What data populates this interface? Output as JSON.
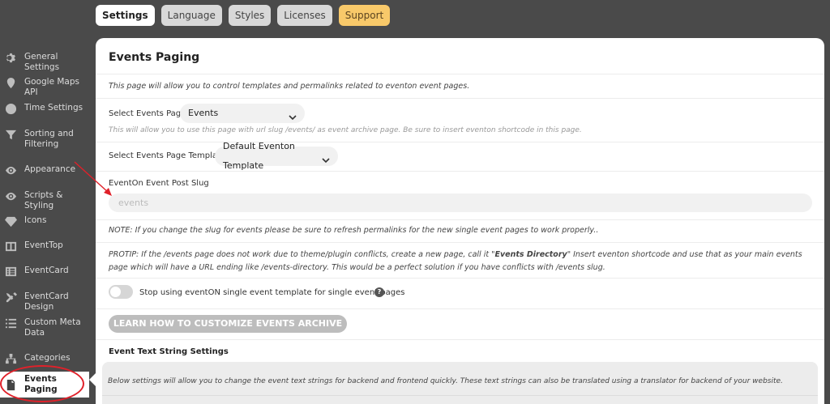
{
  "tabs": [
    {
      "label": "Settings",
      "active": true
    },
    {
      "label": "Language",
      "active": false
    },
    {
      "label": "Styles",
      "active": false
    },
    {
      "label": "Licenses",
      "active": false
    },
    {
      "label": "Support",
      "active": false
    }
  ],
  "sidebar": {
    "items": [
      {
        "label": "General Settings",
        "icon": "gear-icon"
      },
      {
        "label": "Google Maps API",
        "icon": "map-pin-icon"
      },
      {
        "label": "Time Settings",
        "icon": "clock-icon"
      },
      {
        "label": "Sorting and Filtering",
        "icon": "filter-icon"
      },
      {
        "label": "Appearance",
        "icon": "eye-icon"
      },
      {
        "label": "Scripts & Styling",
        "icon": "eye-icon"
      },
      {
        "label": "Icons",
        "icon": "diamond-icon"
      },
      {
        "label": "EventTop",
        "icon": "layout-icon"
      },
      {
        "label": "EventCard",
        "icon": "card-icon"
      },
      {
        "label": "EventCard Design",
        "icon": "tools-icon"
      },
      {
        "label": "Custom Meta Data",
        "icon": "list-icon"
      },
      {
        "label": "Categories",
        "icon": "hierarchy-icon"
      },
      {
        "label": "Events Paging",
        "icon": "file-icon",
        "active": true
      }
    ]
  },
  "main": {
    "title": "Events Paging",
    "intro": "This page will allow you to control templates and permalinks related to eventon event pages.",
    "events_page": {
      "label": "Select Events Page",
      "value": "Events",
      "note": "This will allow you to use this page with url slug /events/ as event archive page. Be sure to insert eventon shortcode in this page."
    },
    "template": {
      "label": "Select Events Page Template",
      "value": "Default Eventon Template"
    },
    "slug": {
      "label": "EventOn Event Post Slug",
      "placeholder": "events"
    },
    "slug_note": "NOTE: If you change the slug for events please be sure to refresh permalinks for the new single event pages to work properly..",
    "protip": {
      "before": "PROTIP: If the /events page does not work due to theme/plugin conflicts, create a new page, call it \"",
      "strong": "Events Directory",
      "after": "\" Insert eventon shortcode and use that as your main events page which will have a URL ending like /events-directory. This would be a perfect solution if you have conflicts with /events slug."
    },
    "toggle": {
      "label": "Stop using eventON single event template for single event pages",
      "on": false,
      "help": "?"
    },
    "learn_button": "LEARN HOW TO CUSTOMIZE EVENTS ARCHIVE PAGE",
    "text_strings": {
      "title": "Event Text String Settings",
      "note": "Below settings will allow you to change the event text strings for backend and frontend quickly. These text strings can also be translated using a translator for backend of your website."
    }
  },
  "colors": {
    "sidebar_bg": "#4a4a4a",
    "support_tab": "#f8c96a",
    "highlight_red": "#e0212a",
    "button_gray": "#bdbdbd"
  }
}
